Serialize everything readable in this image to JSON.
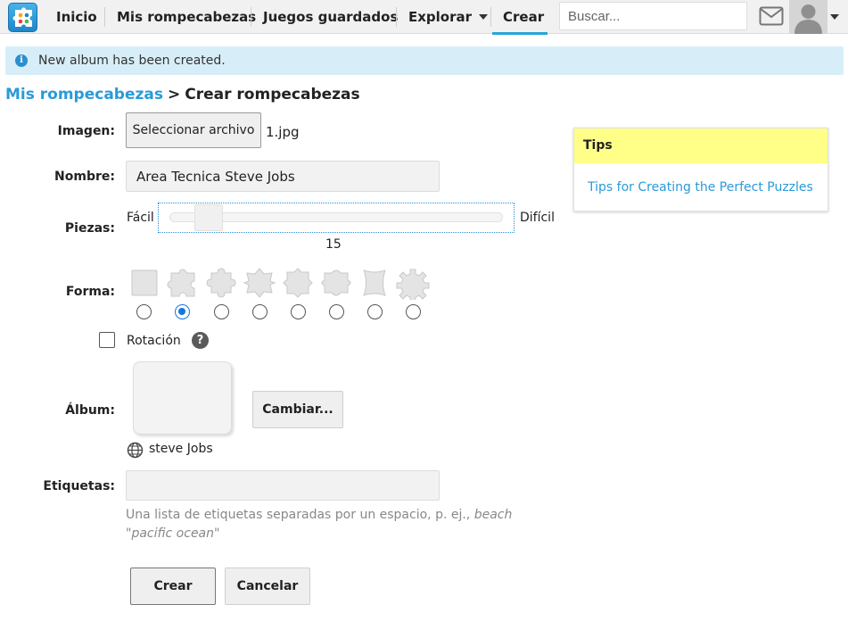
{
  "nav": {
    "items": [
      {
        "label": "Inicio"
      },
      {
        "label": "Mis rompecabezas"
      },
      {
        "label": "Juegos guardados"
      },
      {
        "label": "Explorar"
      },
      {
        "label": "Crear"
      }
    ],
    "active": "Crear",
    "search_placeholder": "Buscar..."
  },
  "alert": {
    "icon": "info-icon",
    "message": "New album has been created."
  },
  "breadcrumb": {
    "parent": "Mis rompecabezas",
    "separator": ">",
    "current": "Crear rompecabezas"
  },
  "form": {
    "image": {
      "label": "Imagen:",
      "button": "Seleccionar archivo",
      "file_name": "1.jpg"
    },
    "name": {
      "label": "Nombre:",
      "value": "Area Tecnica Steve Jobs"
    },
    "pieces": {
      "label": "Piezas:",
      "min_label": "Fácil",
      "max_label": "Difícil",
      "value": "15"
    },
    "shape": {
      "label": "Forma:",
      "options": [
        "square-shape",
        "jigsaw-shape",
        "jigsaw-round-shape",
        "jigsaw-star-shape",
        "jigsaw-cross-shape",
        "jigsaw-leaf-shape",
        "curved-shape",
        "gear-shape"
      ],
      "selected_index": 1
    },
    "rotation": {
      "label": "Rotación",
      "checked": false
    },
    "album": {
      "label": "Álbum:",
      "change_button": "Cambiar...",
      "name": "steve Jobs"
    },
    "tags": {
      "label": "Etiquetas:",
      "value": "",
      "help_prefix": "Una lista de etiquetas separadas por un espacio, p. ej., ",
      "help_example": "beach \"pacific ocean\""
    },
    "submit": "Crear",
    "cancel": "Cancelar"
  },
  "tips": {
    "title": "Tips",
    "link": "Tips for Creating the Perfect Puzzles"
  },
  "colors": {
    "accent": "#2a9ad8",
    "alert_bg": "#d7eef8",
    "tips_header": "#ffff88",
    "radio_checked": "#1777d8"
  }
}
